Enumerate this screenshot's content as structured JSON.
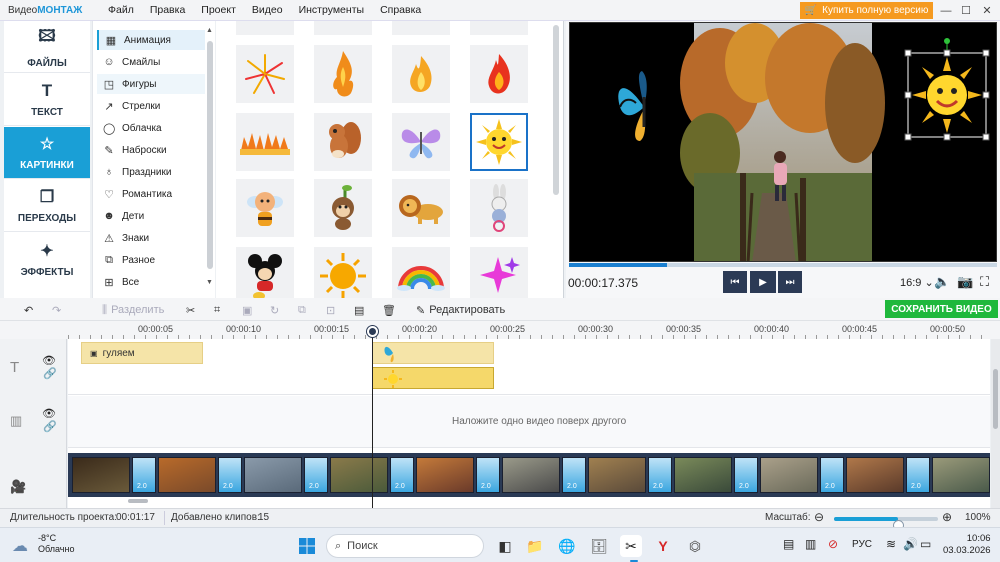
{
  "titlebar": {
    "app_name_a": "Видео",
    "app_name_b": "МОНТАЖ",
    "menu": [
      "Файл",
      "Правка",
      "Проект",
      "Видео",
      "Инструменты",
      "Справка"
    ],
    "buy_label": "Купить полную версию"
  },
  "left_tabs": [
    {
      "label": "ФАЙЛЫ",
      "icon": "image-icon"
    },
    {
      "label": "ТЕКСТ",
      "icon": "text-icon"
    },
    {
      "label": "КАРТИНКИ",
      "icon": "star-icon",
      "active": true
    },
    {
      "label": "ПЕРЕХОДЫ",
      "icon": "transitions-icon"
    },
    {
      "label": "ЭФФЕКТЫ",
      "icon": "effects-icon"
    }
  ],
  "categories": [
    {
      "label": "Анимация",
      "icon": "film-icon"
    },
    {
      "label": "Смайлы",
      "icon": "smiley-icon"
    },
    {
      "label": "Фигуры",
      "icon": "shapes-icon"
    },
    {
      "label": "Стрелки",
      "icon": "arrow-icon"
    },
    {
      "label": "Облачка",
      "icon": "speech-bubble-icon"
    },
    {
      "label": "Наброски",
      "icon": "pencil-icon"
    },
    {
      "label": "Праздники",
      "icon": "balloon-icon"
    },
    {
      "label": "Романтика",
      "icon": "heart-icon"
    },
    {
      "label": "Дети",
      "icon": "child-icon"
    },
    {
      "label": "Знаки",
      "icon": "warning-icon"
    },
    {
      "label": "Разное",
      "icon": "misc-icon"
    },
    {
      "label": "Все",
      "icon": "grid-icon"
    }
  ],
  "gallery": {
    "items": [
      "fireworks",
      "flame",
      "fire",
      "fire-red",
      "fire-row",
      "squirrel",
      "butterfly",
      "sun-smiley",
      "bee-kid",
      "monkey",
      "lion",
      "bunny",
      "mickey",
      "sun",
      "rainbow",
      "sparkles"
    ],
    "selected": "sun-smiley"
  },
  "preview": {
    "time": "00:00:17.375",
    "aspect": "16:9",
    "progress": 0.23
  },
  "toolbar": {
    "split": "Разделить",
    "edit": "Редактировать",
    "save": "СОХРАНИТЬ ВИДЕО"
  },
  "ruler": [
    "00:00:05",
    "00:00:10",
    "00:00:15",
    "00:00:20",
    "00:00:25",
    "00:00:30",
    "00:00:35",
    "00:00:40",
    "00:00:45",
    "00:00:50"
  ],
  "timeline": {
    "text_clip": "гуляем",
    "overlay_hint": "Наложите одно видео поверх другого",
    "transition_label": "2.0"
  },
  "status": {
    "duration_label": "Длительность проекта:",
    "duration": "00:01:17",
    "clips_label": "Добавлено клипов:",
    "clips": "15",
    "zoom_label": "Масштаб:",
    "zoom": "100%",
    "zoom_level": 0.62
  },
  "taskbar": {
    "temp": "-8°C",
    "weather": "Облачно",
    "search": "Поиск",
    "lang": "РУС",
    "time": "10:06",
    "date": "03.03.2026"
  }
}
